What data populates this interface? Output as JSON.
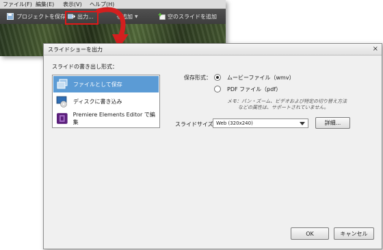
{
  "app": {
    "menu": [
      "ファイル(F)",
      "編集(E)",
      "表示(V)",
      "ヘルプ(H)"
    ],
    "toolbar": {
      "save_project": "プロジェクトを保存",
      "output": "出力...",
      "add_slide": "を追加",
      "add_blank_slide": "空のスライドを追加"
    }
  },
  "dialog": {
    "title": "スライドショーを出力",
    "close_glyph": "×",
    "format_section_label": "スライドの書き出し形式：",
    "formats": [
      {
        "label": "ファイルとして保存",
        "selected": true
      },
      {
        "label": "ディスクに書き込み",
        "selected": false
      },
      {
        "label": "Premiere Elements Editor で編集",
        "selected": false
      }
    ],
    "save_format_label": "保存形式：",
    "save_options": [
      {
        "label": "ムービーファイル（wmv）",
        "checked": true
      },
      {
        "label": "PDF ファイル（pdf）",
        "checked": false
      }
    ],
    "note_line1": "メモ：パン・ズーム、ビデオおよび特定の切り替え方法",
    "note_line2": "などの属性は、サポートされていません。",
    "slide_size_label": "スライドサイズ：",
    "slide_size_value": "Web (320x240)",
    "details_button": "詳細...",
    "ok_button": "OK",
    "cancel_button": "キャンセル"
  },
  "colors": {
    "selection": "#5b9bd5",
    "highlight_box": "#e01818",
    "arrow": "#d41f1f"
  }
}
